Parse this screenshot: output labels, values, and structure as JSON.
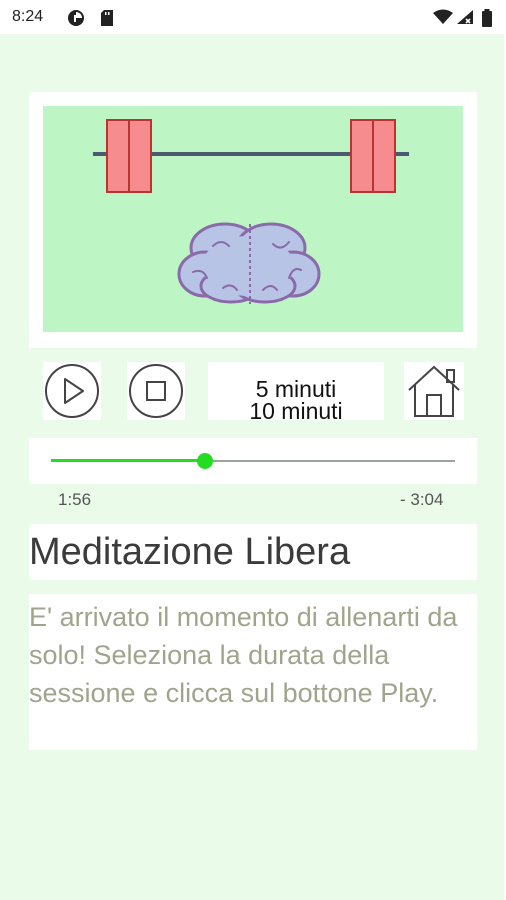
{
  "status_bar": {
    "time": "8:24",
    "left_icons": [
      "data-saver-icon",
      "sd-card-icon"
    ],
    "right_icons": [
      "wifi-icon",
      "signal-icon",
      "battery-icon"
    ]
  },
  "banner": {
    "image": "barbell-brain-illustration"
  },
  "controls": {
    "play_icon": "play-icon",
    "stop_icon": "stop-icon",
    "home_icon": "home-icon",
    "duration_options": [
      "5 minuti",
      "10 minuti"
    ]
  },
  "player": {
    "progress_fraction": 0.38,
    "elapsed": "1:56",
    "remaining": "- 3:04",
    "accent_color": "#22dd22"
  },
  "content": {
    "title": "Meditazione Libera",
    "description": "E' arrivato il momento di allenarti da solo! Seleziona la durata della sessione e clicca sul bottone Play."
  }
}
